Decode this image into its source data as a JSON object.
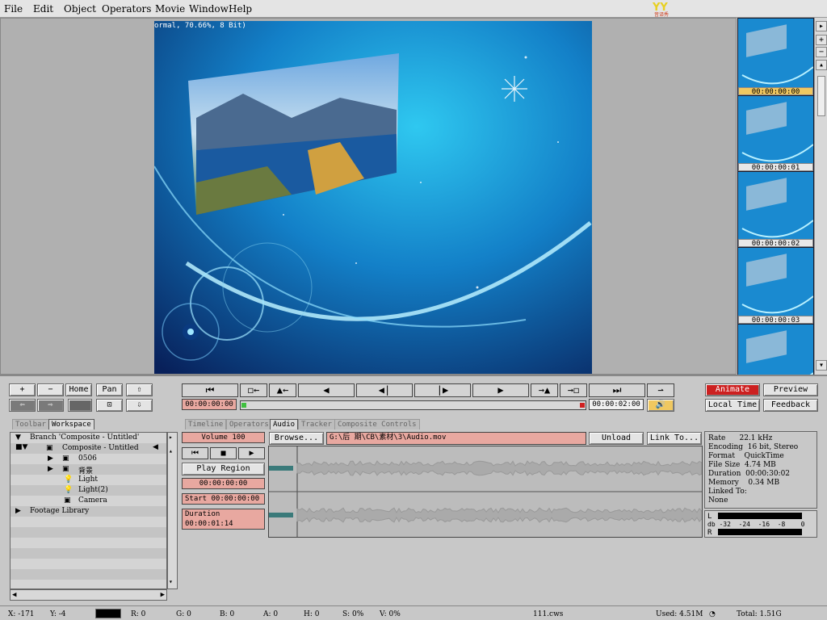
{
  "menu": [
    "File",
    "Edit",
    "Object",
    "Operators",
    "Movie",
    "Window",
    "Help"
  ],
  "logo_text": "YY 音译秀",
  "viewer": {
    "info": "ormal, 70.66%, 8 Bit)"
  },
  "thumbnails": [
    {
      "timecode": "00:00:00:00",
      "selected": true
    },
    {
      "timecode": "00:00:00:01",
      "selected": false
    },
    {
      "timecode": "00:00:00:02",
      "selected": false
    },
    {
      "timecode": "00:00:00:03",
      "selected": false
    },
    {
      "timecode": "",
      "selected": false
    }
  ],
  "toolbar_left": {
    "plus": "+",
    "minus": "−",
    "home": "Home",
    "pan": "Pan"
  },
  "transport": {
    "current_time": "00:00:00:00",
    "end_time": "00:00:02:00",
    "animate": "Animate",
    "preview": "Preview",
    "local_time": "Local Time",
    "feedback": "Feedback"
  },
  "tabs_left": [
    "Toolbar",
    "Workspace"
  ],
  "tabs_right": [
    "Timeline",
    "Operators",
    "Audio",
    "Tracker",
    "Composite Controls"
  ],
  "tree": [
    {
      "label": "Branch 'Composite - Untitled'"
    },
    {
      "label": "Composite - Untitled"
    },
    {
      "label": "0506"
    },
    {
      "label": "背景"
    },
    {
      "label": "Light"
    },
    {
      "label": "Light(2)"
    },
    {
      "label": "Camera"
    },
    {
      "label": "Footage Library"
    }
  ],
  "audio": {
    "volume": "Volume 100",
    "browse": "Browse...",
    "path": "G:\\后 期\\CB\\素材\\3\\Audio.mov",
    "unload": "Unload",
    "link_to": "Link To...",
    "play_region": "Play Region",
    "time": "00:00:00:00",
    "start": "Start 00:00:00:00",
    "duration": "Duration 00:00:01:14"
  },
  "audio_info": [
    {
      "key": "Rate",
      "value": "22.1 kHz"
    },
    {
      "key": "Encoding",
      "value": "16 bit, Stereo"
    },
    {
      "key": "Format",
      "value": "QuickTime"
    },
    {
      "key": "File Size",
      "value": "4.74 MB"
    },
    {
      "key": "Duration",
      "value": "00:00:30:02"
    },
    {
      "key": "Memory",
      "value": "0.34 MB"
    },
    {
      "key": "Linked To:",
      "value": ""
    },
    {
      "key": "None",
      "value": ""
    }
  ],
  "vu": {
    "l": "L",
    "r": "R",
    "scale": "db -32  -24  -16  -8    0"
  },
  "status": {
    "x": "X:  -171",
    "y": "Y:   -4",
    "r": "R: 0",
    "g": "G: 0",
    "b": "B: 0",
    "a": "A: 0",
    "h": "H: 0",
    "s": "S: 0%",
    "v": "V: 0%",
    "file": "111.cws",
    "used": "Used: 4.51M",
    "total": "Total: 1.51G"
  },
  "colors": {
    "animate_red": "#cc2020",
    "pink_field": "#e8a8a0",
    "selected_thumb": "#f0c860",
    "sky_blue": "#1a9ed6"
  }
}
